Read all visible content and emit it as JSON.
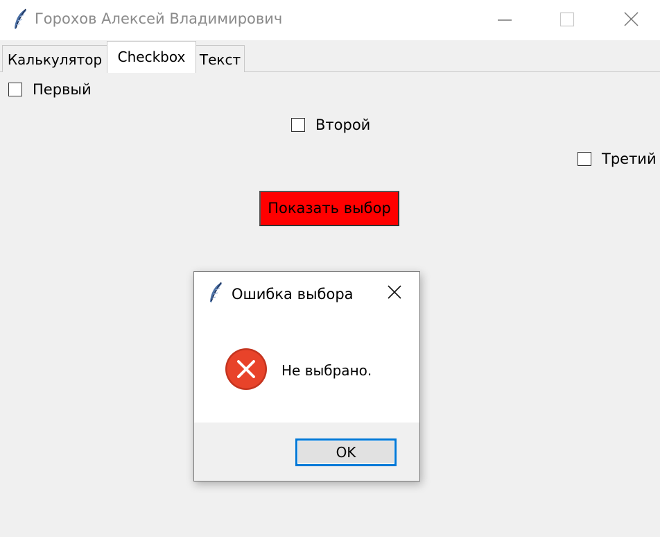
{
  "window": {
    "title": "Горохов Алексей Владимирович",
    "app_icon": "tk-feather-icon",
    "controls": [
      "minimize-icon",
      "maximize-icon",
      "close-icon"
    ]
  },
  "tabs": [
    {
      "label": "Калькулятор",
      "selected": false
    },
    {
      "label": "Checkbox",
      "selected": true
    },
    {
      "label": "Текст",
      "selected": false
    }
  ],
  "checkboxes": [
    {
      "label": "Первый",
      "checked": false
    },
    {
      "label": "Второй",
      "checked": false
    },
    {
      "label": "Третий",
      "checked": false
    }
  ],
  "show_button": {
    "label": "Показать выбор",
    "color": "#ff0000"
  },
  "dialog": {
    "title": "Ошибка выбора",
    "message": "Не выбрано.",
    "icon": "error-icon",
    "ok_label": "OK",
    "accent": "#0078d7"
  }
}
